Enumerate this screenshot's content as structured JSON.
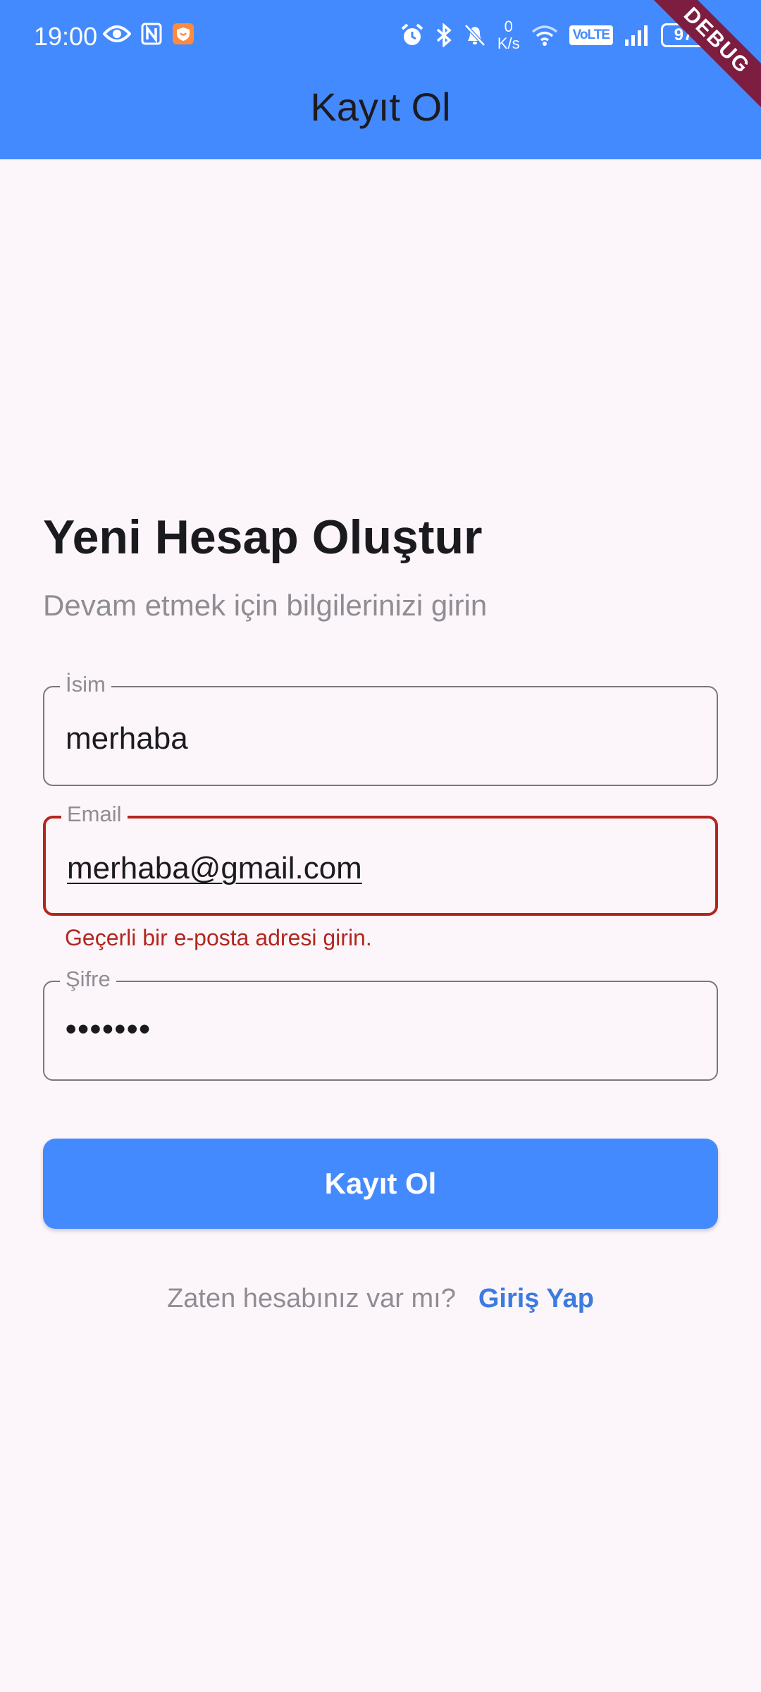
{
  "status_bar": {
    "time": "19:00",
    "left_icons": [
      "eye-icon",
      "nfc-icon",
      "app-shield-icon"
    ],
    "speed_value": "0",
    "speed_unit": "K/s",
    "volte": "VoLTE",
    "battery": "97",
    "right_icons": [
      "alarm-icon",
      "bluetooth-icon",
      "bell-off-icon",
      "wifi-icon",
      "signal-icon"
    ]
  },
  "debug_banner": "DEBUG",
  "app_bar": {
    "title": "Kayıt Ol"
  },
  "form": {
    "heading": "Yeni Hesap Oluştur",
    "subheading": "Devam etmek için bilgilerinizi girin",
    "name_field": {
      "label": "İsim",
      "value": "merhaba"
    },
    "email_field": {
      "label": "Email",
      "value": "merhaba@gmail.com",
      "error": "Geçerli bir e-posta adresi girin."
    },
    "password_field": {
      "label": "Şifre",
      "value": "•••••••"
    },
    "submit_label": "Kayıt Ol",
    "login_question": "Zaten hesabınız var mı?",
    "login_link": "Giriş Yap"
  },
  "colors": {
    "primary": "#448aff",
    "background": "#fcf6fb",
    "error": "#b3261e",
    "debug_ribbon": "#7d1d3f"
  }
}
